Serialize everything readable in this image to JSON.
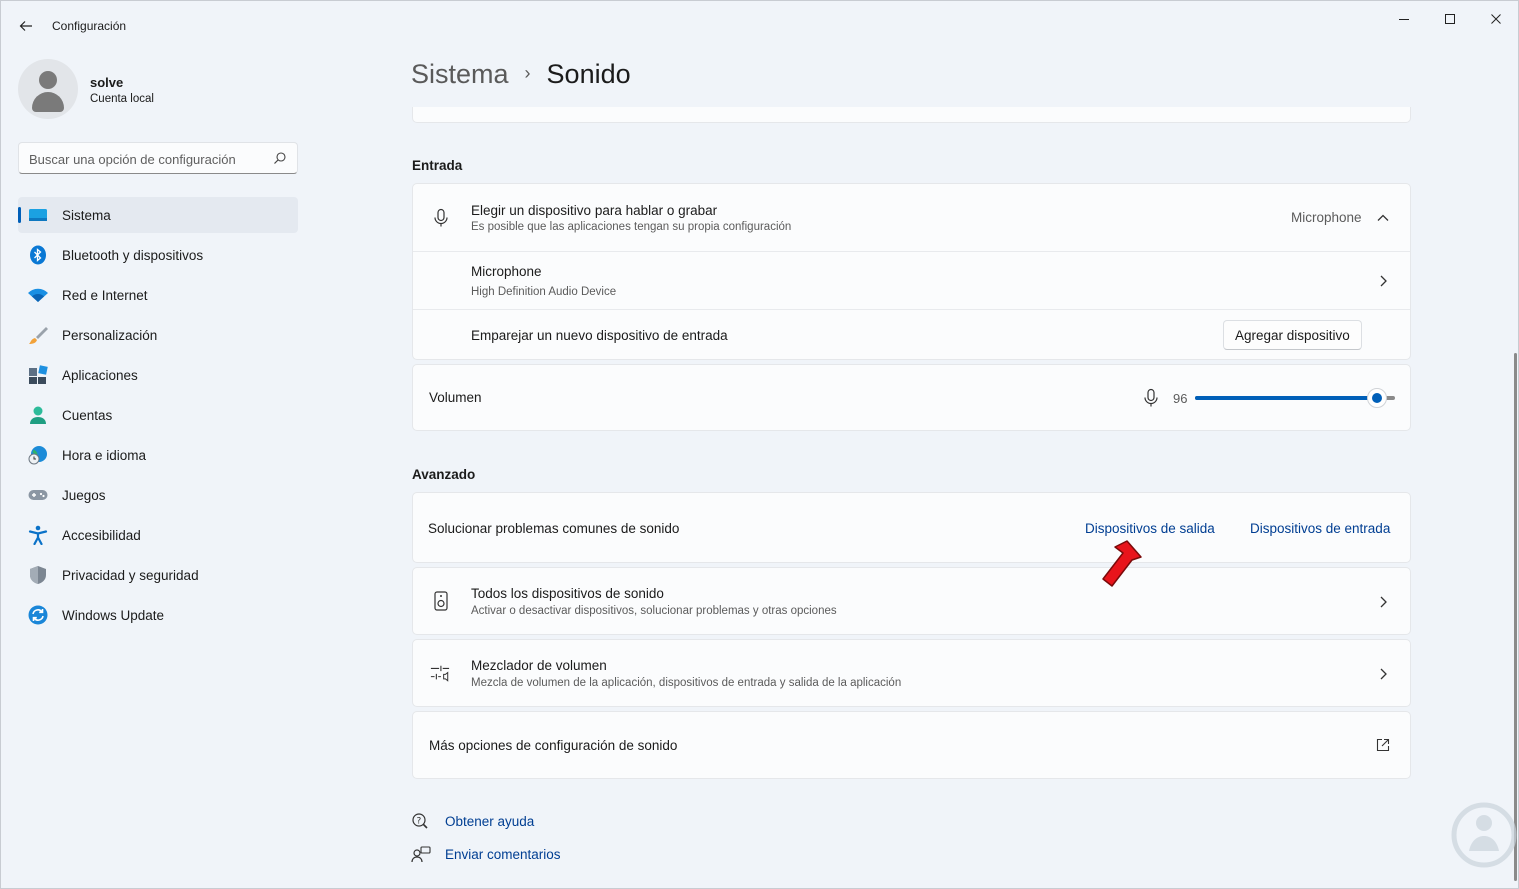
{
  "window": {
    "app_title": "Configuración"
  },
  "profile": {
    "name": "solve",
    "account_type": "Cuenta local"
  },
  "search": {
    "placeholder": "Buscar una opción de configuración"
  },
  "sidebar": {
    "items": [
      {
        "label": "Sistema",
        "icon": "monitor-icon",
        "selected": true
      },
      {
        "label": "Bluetooth y dispositivos",
        "icon": "bluetooth-icon"
      },
      {
        "label": "Red e Internet",
        "icon": "wifi-icon"
      },
      {
        "label": "Personalización",
        "icon": "brush-icon"
      },
      {
        "label": "Aplicaciones",
        "icon": "apps-icon"
      },
      {
        "label": "Cuentas",
        "icon": "person-icon"
      },
      {
        "label": "Hora e idioma",
        "icon": "globe-clock-icon"
      },
      {
        "label": "Juegos",
        "icon": "gamepad-icon"
      },
      {
        "label": "Accesibilidad",
        "icon": "accessibility-icon"
      },
      {
        "label": "Privacidad y seguridad",
        "icon": "shield-icon"
      },
      {
        "label": "Windows Update",
        "icon": "update-icon"
      }
    ]
  },
  "breadcrumb": {
    "parent": "Sistema",
    "separator": "›",
    "current": "Sonido"
  },
  "input_section": {
    "title": "Entrada",
    "choose_device": {
      "title": "Elegir un dispositivo para hablar o grabar",
      "subtitle": "Es posible que las aplicaciones tengan su propia configuración",
      "value": "Microphone"
    },
    "device": {
      "title": "Microphone",
      "subtitle": "High Definition Audio Device"
    },
    "pair": {
      "title": "Emparejar un nuevo dispositivo de entrada",
      "button": "Agregar dispositivo"
    },
    "volume": {
      "label": "Volumen",
      "value": "96",
      "level_percent": 96
    }
  },
  "advanced_section": {
    "title": "Avanzado",
    "troubleshoot": {
      "title": "Solucionar problemas comunes de sonido",
      "link_output": "Dispositivos de salida",
      "link_input": "Dispositivos de entrada"
    },
    "all_devices": {
      "title": "Todos los dispositivos de sonido",
      "subtitle": "Activar o desactivar dispositivos, solucionar problemas y otras opciones"
    },
    "mixer": {
      "title": "Mezclador de volumen",
      "subtitle": "Mezcla de volumen de la aplicación, dispositivos de entrada y salida de la aplicación"
    },
    "more": {
      "title": "Más opciones de configuración de sonido"
    }
  },
  "footer": {
    "help": "Obtener ayuda",
    "feedback": "Enviar comentarios"
  },
  "colors": {
    "accent": "#005fb8",
    "link": "#003e92",
    "arrow": "#e8141b"
  }
}
